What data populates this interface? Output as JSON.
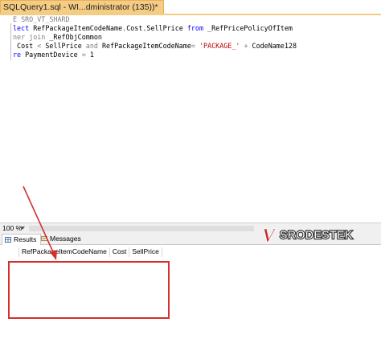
{
  "tab": {
    "title": "SQLQuery1.sql - WI...dministrator (135))*"
  },
  "editor": {
    "lines": [
      [
        {
          "t": "E SRO_VT_SHARD",
          "c": "gr"
        }
      ],
      [
        {
          "t": "lect ",
          "c": "kw"
        },
        {
          "t": "RefPackageItemCodeName",
          "c": ""
        },
        {
          "t": ",",
          "c": "gr"
        },
        {
          "t": "Cost",
          "c": ""
        },
        {
          "t": ",",
          "c": "gr"
        },
        {
          "t": "SellPrice ",
          "c": ""
        },
        {
          "t": "from",
          "c": "kw"
        },
        {
          "t": " _RefPricePolicyOfItem",
          "c": ""
        }
      ],
      [
        {
          "t": "ner join",
          "c": "gr"
        },
        {
          "t": " _RefObjCommon",
          "c": ""
        }
      ],
      [
        {
          "t": " Cost ",
          "c": ""
        },
        {
          "t": "<",
          "c": "gr"
        },
        {
          "t": " SellPrice ",
          "c": ""
        },
        {
          "t": "and",
          "c": "gr"
        },
        {
          "t": " RefPackageItemCodeName",
          "c": ""
        },
        {
          "t": "=",
          "c": "gr"
        },
        {
          "t": " ",
          "c": ""
        },
        {
          "t": "'PACKAGE_'",
          "c": "str"
        },
        {
          "t": " ",
          "c": ""
        },
        {
          "t": "+",
          "c": "gr"
        },
        {
          "t": " CodeName128",
          "c": ""
        }
      ],
      [
        {
          "t": "re",
          "c": "kw"
        },
        {
          "t": " PaymentDevice ",
          "c": ""
        },
        {
          "t": "=",
          "c": "gr"
        },
        {
          "t": " 1",
          "c": ""
        }
      ]
    ]
  },
  "zoom": {
    "level": "100 %"
  },
  "results_tabs": [
    {
      "label": "Results",
      "icon": "grid-icon",
      "active": true
    },
    {
      "label": "Messages",
      "icon": "message-icon",
      "active": false
    }
  ],
  "grid": {
    "columns": [
      "RefPackageItemCodeName",
      "Cost",
      "SellPrice"
    ]
  },
  "watermark": {
    "text": "SRODESTEK",
    "letter": "V"
  },
  "colors": {
    "tab": "#f5cc84",
    "annotation": "#d62f2f",
    "keyword": "#0000ff",
    "string": "#c00000"
  }
}
